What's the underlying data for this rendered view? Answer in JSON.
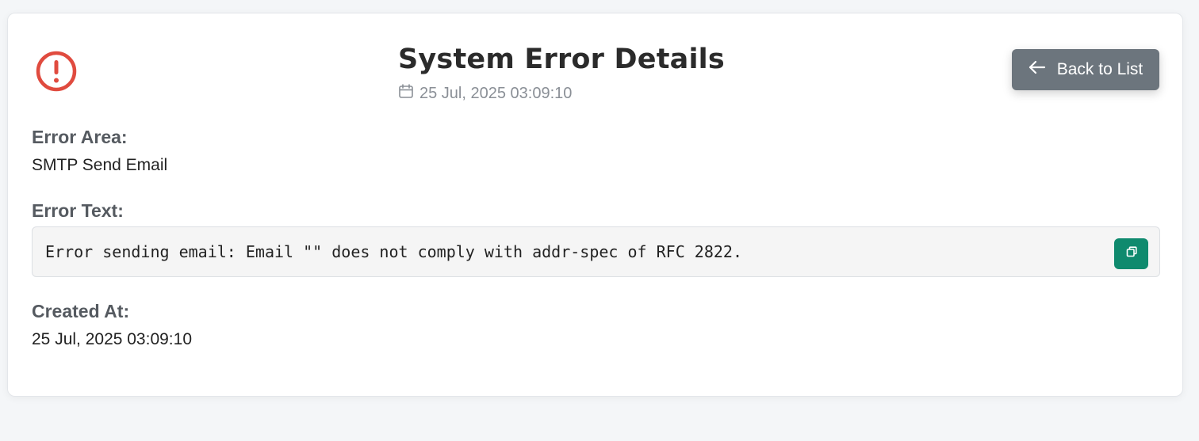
{
  "header": {
    "title": "System Error Details",
    "date": "25 Jul, 2025 03:09:10",
    "back_label": "Back to List"
  },
  "fields": {
    "area_label": "Error Area:",
    "area_value": "SMTP Send Email",
    "text_label": "Error Text:",
    "text_value": "Error sending email: Email \"\" does not comply with addr-spec of RFC 2822.",
    "created_label": "Created At:",
    "created_value": "25 Jul, 2025 03:09:10"
  },
  "icons": {
    "alert": "exclamation-circle-icon",
    "calendar": "calendar-icon",
    "back": "arrow-left-icon",
    "copy": "copy-icon"
  },
  "colors": {
    "alert": "#e04b3f",
    "back_button": "#6c757d",
    "copy_button": "#0f8a6e"
  }
}
